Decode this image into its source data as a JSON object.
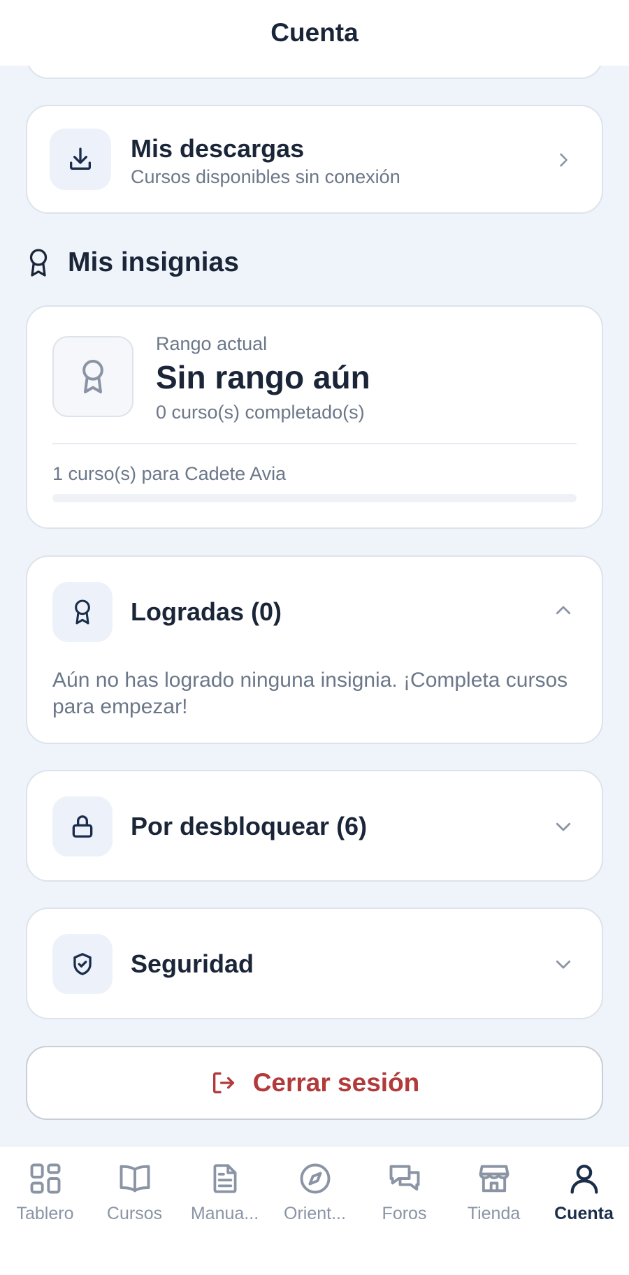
{
  "header": {
    "title": "Cuenta"
  },
  "downloads": {
    "title": "Mis descargas",
    "subtitle": "Cursos disponibles sin conexión",
    "icon": "download-icon"
  },
  "badges_section": {
    "heading": "Mis insignias",
    "icon": "award-icon"
  },
  "rank": {
    "caption": "Rango actual",
    "name": "Sin rango aún",
    "completed": "0 curso(s) completado(s)",
    "next": "1 curso(s) para Cadete Avia",
    "progress": 0
  },
  "achieved": {
    "title": "Logradas (0)",
    "empty_message": "Aún no has logrado ninguna insignia. ¡Completa cursos para empezar!",
    "expanded": true
  },
  "locked": {
    "title": "Por desbloquear (6)",
    "icon": "lock-icon"
  },
  "security": {
    "title": "Seguridad",
    "icon": "shield-check-icon"
  },
  "logout": {
    "label": "Cerrar sesión",
    "color": "#b23a3a"
  },
  "tabs": [
    {
      "label": "Tablero",
      "icon": "grid-icon",
      "active": false
    },
    {
      "label": "Cursos",
      "icon": "book-icon",
      "active": false
    },
    {
      "label": "Manua...",
      "icon": "document-icon",
      "active": false
    },
    {
      "label": "Orient...",
      "icon": "compass-icon",
      "active": false
    },
    {
      "label": "Foros",
      "icon": "chat-icon",
      "active": false
    },
    {
      "label": "Tienda",
      "icon": "store-icon",
      "active": false
    },
    {
      "label": "Cuenta",
      "icon": "user-icon",
      "active": true
    }
  ],
  "colors": {
    "accent": "#1a2e4c",
    "background": "#eff4fb",
    "danger": "#b23a3a"
  }
}
